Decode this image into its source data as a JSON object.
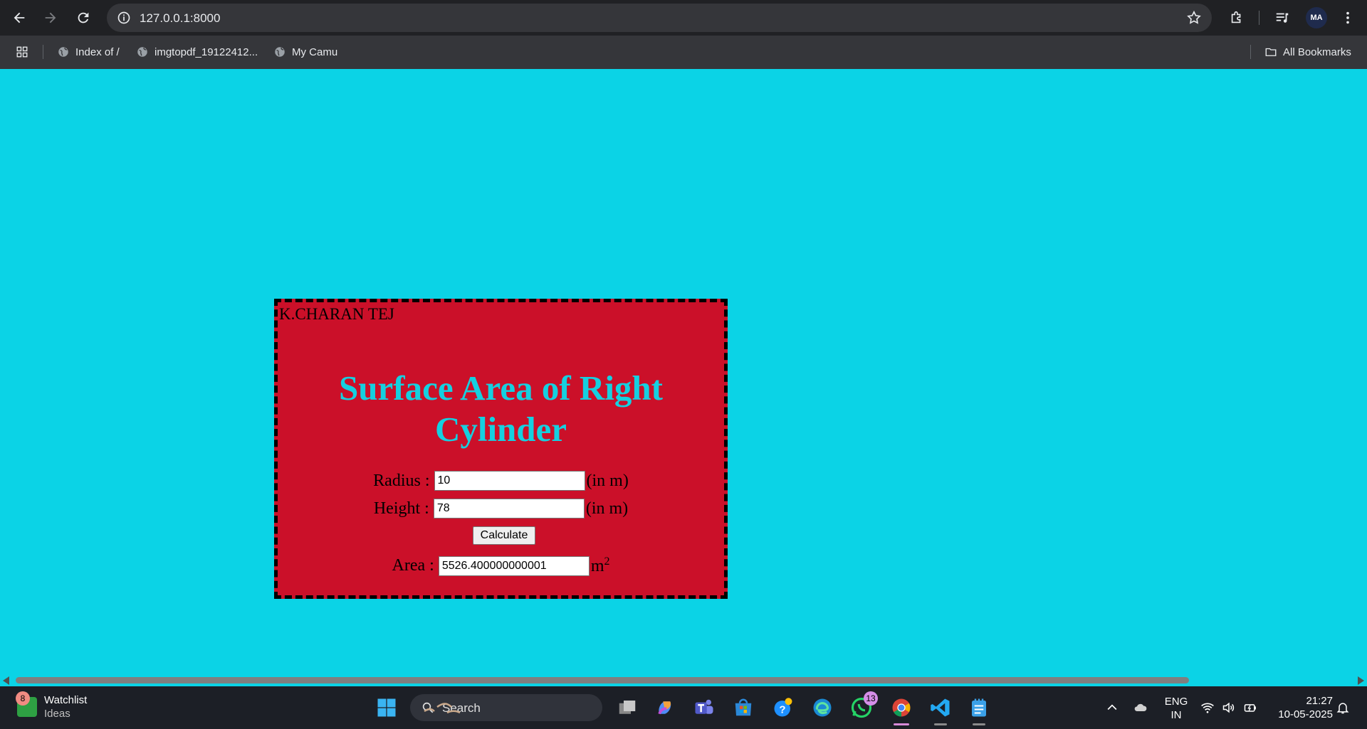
{
  "browser": {
    "url": "127.0.0.1:8000",
    "bookmarks": [
      "Index of /",
      "imgtopdf_19122412...",
      "My Camu"
    ],
    "all_bookmarks": "All Bookmarks",
    "avatar_text": "MA"
  },
  "page": {
    "author": "K.CHARAN TEJ",
    "title": "Surface Area of Right Cylinder",
    "radius_label": "Radius :",
    "radius_value": "10",
    "height_label": "Height :",
    "height_value": "78",
    "unit": "(in m)",
    "calculate_label": "Calculate",
    "area_label": "Area :",
    "area_value": "5526.400000000001",
    "area_unit": "m",
    "area_unit_sup": "2",
    "colors": {
      "background": "#0bd3e6",
      "card": "#cb1029",
      "title": "#15d0e0"
    }
  },
  "taskbar": {
    "widget_title": "Watchlist",
    "widget_sub": "Ideas",
    "widget_badge": "8",
    "search_label": "Search",
    "whatsapp_badge": "13",
    "language_top": "ENG",
    "language_bottom": "IN",
    "time": "21:27",
    "date": "10-05-2025"
  }
}
